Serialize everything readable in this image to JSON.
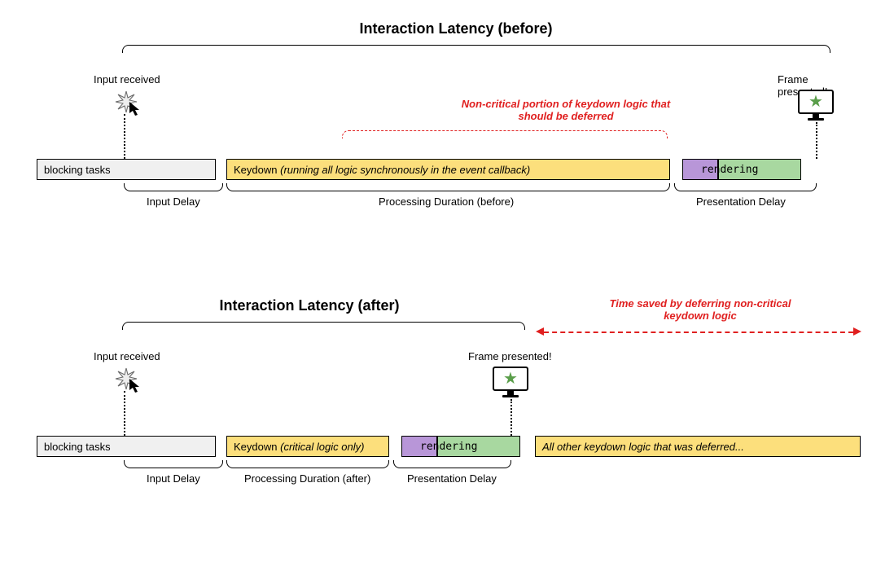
{
  "before": {
    "title": "Interaction Latency (before)",
    "input_received": "Input received",
    "frame_presented": "Frame presented!",
    "red_note": "Non-critical portion of keydown logic that should be deferred",
    "blocking": "blocking tasks",
    "keydown_prefix": "Keydown",
    "keydown_italic": "(running all logic synchronously in the event callback)",
    "rendering": "rendering",
    "input_delay": "Input Delay",
    "processing": "Processing Duration (before)",
    "presentation_delay": "Presentation Delay"
  },
  "after": {
    "title": "Interaction Latency (after)",
    "time_saved": "Time saved by deferring non-critical keydown logic",
    "input_received": "Input received",
    "frame_presented": "Frame presented!",
    "blocking": "blocking tasks",
    "keydown_prefix": "Keydown",
    "keydown_italic": "(critical logic only)",
    "rendering": "rendering",
    "deferred": "All other keydown logic that was deferred...",
    "input_delay": "Input Delay",
    "processing": "Processing Duration (after)",
    "presentation_delay": "Presentation Delay"
  }
}
